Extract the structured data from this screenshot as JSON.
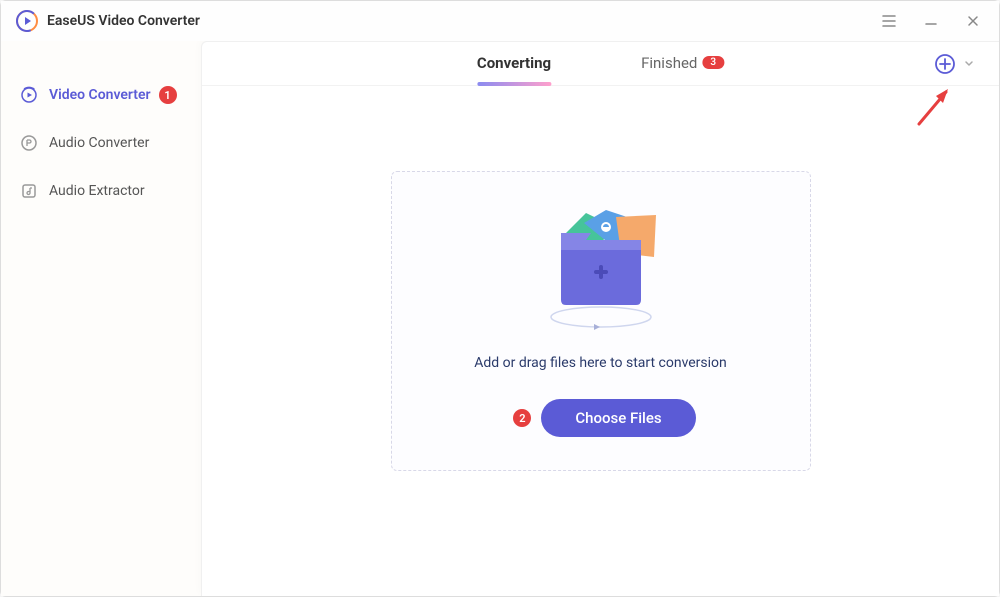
{
  "app": {
    "title": "EaseUS Video Converter"
  },
  "sidebar": {
    "items": [
      {
        "label": "Video Converter"
      },
      {
        "label": "Audio Converter"
      },
      {
        "label": "Audio Extractor"
      }
    ]
  },
  "tabs": {
    "converting": "Converting",
    "finished": "Finished",
    "finished_count": "3"
  },
  "dropzone": {
    "hint": "Add or drag files here to start conversion",
    "choose_label": "Choose Files"
  },
  "callouts": {
    "one": "1",
    "two": "2"
  }
}
